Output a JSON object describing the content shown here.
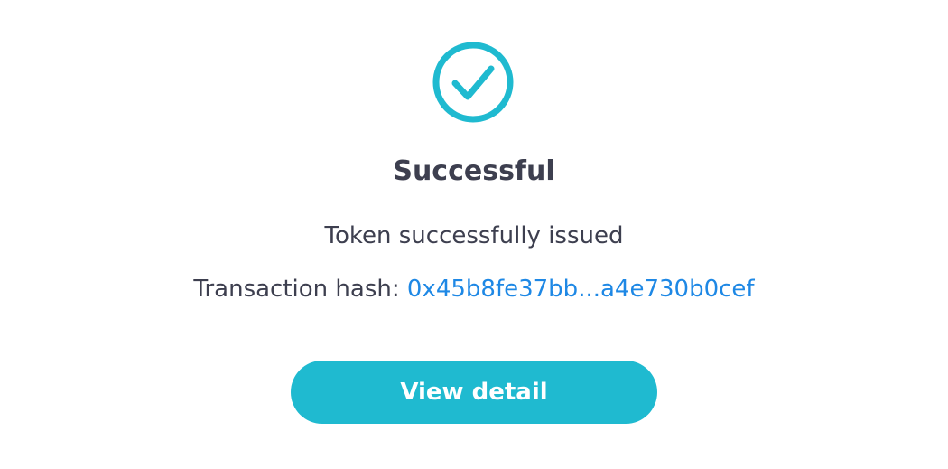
{
  "status": {
    "icon": "check-circle-icon",
    "accent_color": "#1fbad0",
    "title": "Successful",
    "message": "Token successfully issued"
  },
  "transaction": {
    "label": "Transaction hash:",
    "hash_display": "0x45b8fe37bb...a4e730b0cef",
    "link_color": "#1e88e5"
  },
  "actions": {
    "view_detail_label": "View detail"
  }
}
